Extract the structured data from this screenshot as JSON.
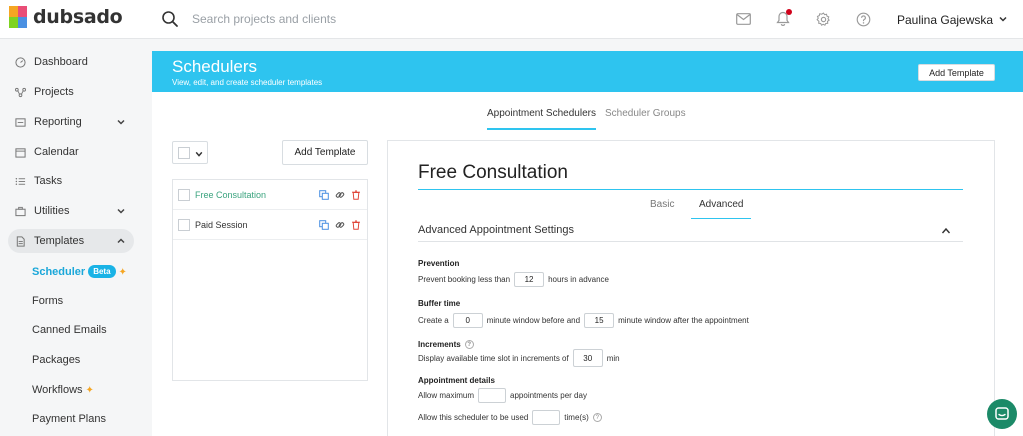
{
  "app": {
    "brand": "dubsado"
  },
  "topbar": {
    "search_placeholder": "Search projects and clients",
    "user_name": "Paulina Gajewska"
  },
  "sidebar": {
    "items": [
      {
        "label": "Dashboard"
      },
      {
        "label": "Projects"
      },
      {
        "label": "Reporting"
      },
      {
        "label": "Calendar"
      },
      {
        "label": "Tasks"
      },
      {
        "label": "Utilities"
      },
      {
        "label": "Templates"
      }
    ],
    "sub_items": [
      {
        "label": "Scheduler",
        "badge": "Beta"
      },
      {
        "label": "Forms"
      },
      {
        "label": "Canned Emails"
      },
      {
        "label": "Packages"
      },
      {
        "label": "Workflows"
      },
      {
        "label": "Payment Plans"
      }
    ]
  },
  "banner": {
    "title": "Schedulers",
    "subtitle": "View, edit, and create scheduler templates",
    "button": "Add Template"
  },
  "tabs": [
    {
      "label": "Appointment Schedulers"
    },
    {
      "label": "Scheduler Groups"
    }
  ],
  "left_panel": {
    "add_button": "Add Template",
    "templates": [
      {
        "name": "Free Consultation",
        "active": true
      },
      {
        "name": "Paid Session",
        "active": false
      }
    ]
  },
  "editor": {
    "title": "Free Consultation",
    "subtabs": [
      {
        "label": "Basic"
      },
      {
        "label": "Advanced"
      }
    ],
    "section_title": "Advanced Appointment Settings",
    "prevention": {
      "heading": "Prevention",
      "before": "Prevent booking less than",
      "value": "12",
      "after": "hours in advance"
    },
    "buffer": {
      "heading": "Buffer time",
      "pre": "Create a",
      "before_value": "0",
      "mid": "minute window before and",
      "after_value": "15",
      "post": "minute window after the appointment"
    },
    "increments": {
      "heading": "Increments",
      "before": "Display available time slot in increments of",
      "value": "30",
      "after": "min"
    },
    "details": {
      "heading": "Appointment details",
      "max_before": "Allow maximum",
      "max_value": "",
      "max_after": "appointments per day",
      "used_before": "Allow this scheduler to be used",
      "used_value": "",
      "used_after": "time(s)"
    }
  },
  "colors": {
    "accent": "#2ec4ef",
    "active_link": "#1aa7d9",
    "template_active": "#3aa37e",
    "danger": "#e0463a",
    "chat": "#1c8a68"
  }
}
